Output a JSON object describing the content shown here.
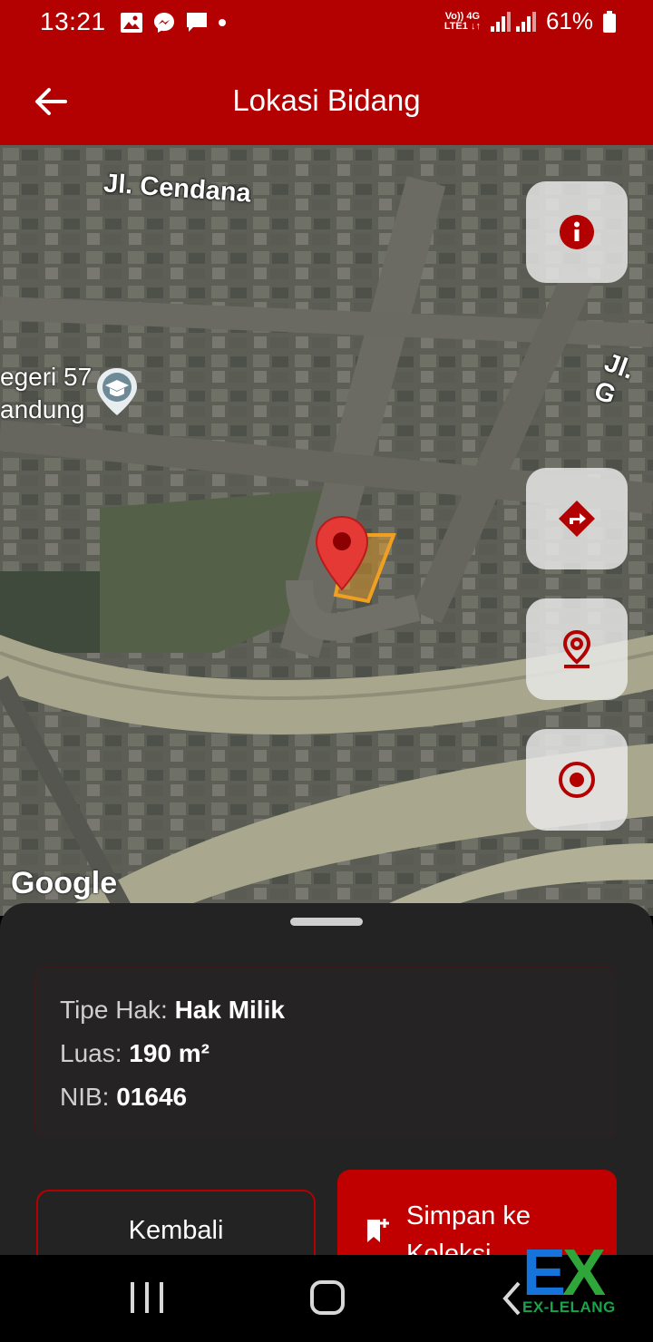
{
  "status_bar": {
    "time": "13:21",
    "network_top": "Vo)) 4G",
    "network_bottom": "LTE1 ↓↑",
    "battery": "61%"
  },
  "app_bar": {
    "title": "Lokasi Bidang",
    "back_icon": "arrow-left-icon"
  },
  "map": {
    "road_label_1": "Jl. Cendana",
    "road_label_2": "Jl. G",
    "school_label_line1": "egeri 57",
    "school_label_line2": "andung",
    "attribution": "Google",
    "buttons": [
      "info-icon",
      "directions-icon",
      "location-pin-icon",
      "target-icon"
    ]
  },
  "details": {
    "tipe_hak_label": "Tipe Hak: ",
    "tipe_hak_value": "Hak Milik",
    "luas_label": "Luas: ",
    "luas_value": "190 m²",
    "nib_label": "NIB: ",
    "nib_value": "01646"
  },
  "actions": {
    "back_label": "Kembali",
    "save_label_line1": "Simpan ke",
    "save_label_line2": "Koleksi"
  },
  "watermark": {
    "letter1": "E",
    "letter2": "X",
    "text": "EX-LELANG"
  },
  "colors": {
    "primary": "#b30000",
    "sheet": "#232323",
    "parcel": "#f0a020"
  }
}
